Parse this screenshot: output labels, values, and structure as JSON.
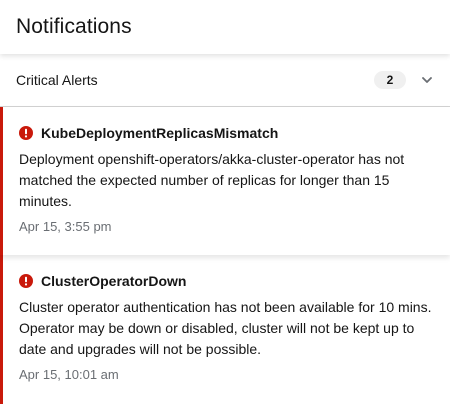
{
  "header": {
    "title": "Notifications"
  },
  "group": {
    "title": "Critical Alerts",
    "count": "2",
    "toggle_icon": "chevron-down-icon"
  },
  "colors": {
    "critical": "#c9190b",
    "badge_bg": "#f0f0f0",
    "muted_text": "#6a6e73"
  },
  "notifications": [
    {
      "icon": "exclamation-circle-icon",
      "title": "KubeDeploymentReplicasMismatch",
      "description": "Deployment openshift-operators/akka-cluster-operator has not matched the expected number of replicas for longer than 15 minutes.",
      "timestamp": "Apr 15, 3:55 pm"
    },
    {
      "icon": "exclamation-circle-icon",
      "title": "ClusterOperatorDown",
      "description": "Cluster operator authentication has not been available for 10 mins. Operator may be down or disabled, cluster will not be kept up to date and upgrades will not be possible.",
      "timestamp": "Apr 15, 10:01 am"
    }
  ]
}
